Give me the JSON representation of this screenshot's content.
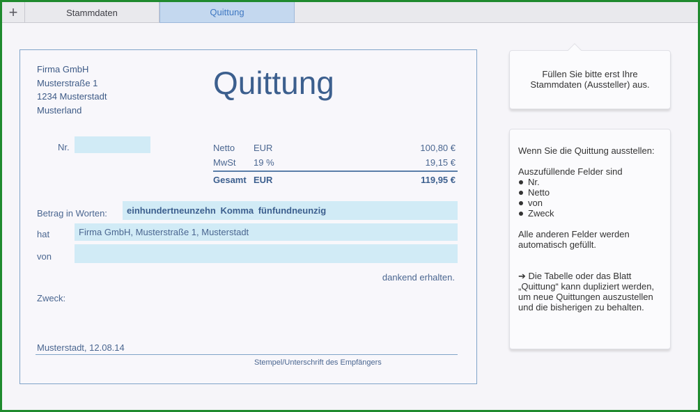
{
  "tabs": {
    "add_label": "+",
    "stammdaten": "Stammdaten",
    "quittung": "Quittung"
  },
  "receipt": {
    "address": [
      "Firma GmbH",
      "Musterstraße 1",
      "1234 Musterstadt",
      "Musterland"
    ],
    "title": "Quittung",
    "nr_label": "Nr.",
    "nr_value": "",
    "summary": [
      {
        "label": "Netto",
        "currency": "EUR",
        "value": "100,80 €"
      },
      {
        "label": "MwSt",
        "currency": "19 %",
        "value": "19,15 €"
      },
      {
        "label": "Gesamt",
        "currency": "EUR",
        "value": "119,95 €"
      }
    ],
    "betrag_label": "Betrag in Worten:",
    "betrag_value": "einhundertneunzehn Komma fünfundneunzig",
    "hat_label": "hat",
    "hat_value": "Firma GmbH, Musterstraße 1, Musterstadt",
    "von_label": "von",
    "von_value": "",
    "dankend": "dankend erhalten.",
    "zweck_label": "Zweck:",
    "ort_datum": "Musterstadt, 12.08.14",
    "signature_label": "Stempel/Unterschrift des Empfängers"
  },
  "panel1": {
    "message_line1": "Füllen Sie bitte erst Ihre",
    "message_line2": "Stammdaten (Aussteller) aus."
  },
  "panel2": {
    "intro": "Wenn Sie die Quittung ausstellen:",
    "list_heading": "Auszufüllende Felder sind",
    "fields": [
      "Nr.",
      "Netto",
      "von",
      "Zweck"
    ],
    "auto": "Alle anderen Felder werden automatisch gefüllt.",
    "tip": "➔ Die Tabelle oder das Blatt „Quittung“ kann dupliziert werden, um neue Quittungen auszustellen und die bisherigen zu behalten."
  },
  "colors": {
    "frame": "#1f8a2e",
    "field_bg": "#d1ebf6",
    "text_blue": "#3c5f8e",
    "active_tab": "#c4d8ef"
  }
}
